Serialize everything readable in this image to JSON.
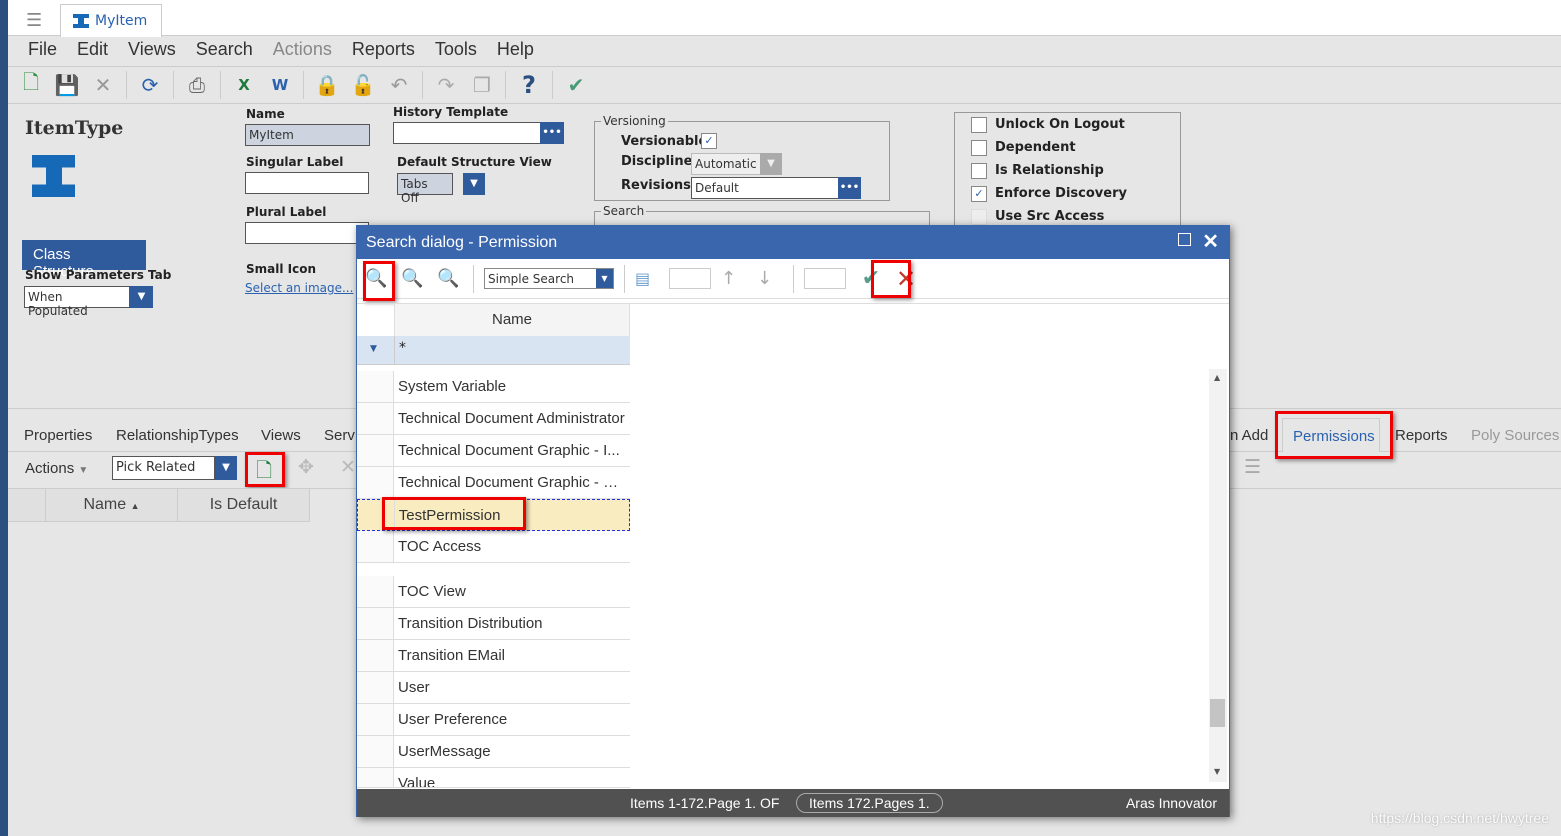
{
  "window": {
    "tab_title": "MyItem"
  },
  "menu": [
    "File",
    "Edit",
    "Views",
    "Search",
    "Actions",
    "Reports",
    "Tools",
    "Help"
  ],
  "form": {
    "heading": "ItemType",
    "class_structure": "Class Structure",
    "show_params_label": "Show Parameters Tab",
    "show_params_value": "When Populated",
    "name_label": "Name",
    "name_value": "MyItem",
    "singular_label": "Singular Label",
    "plural_label": "Plural Label",
    "small_icon_label": "Small Icon",
    "select_image": "Select an image...",
    "history_label": "History Template",
    "structure_view_label": "Default Structure View",
    "structure_view_value": "Tabs Off",
    "versioning_legend": "Versioning",
    "versionable": "Versionable",
    "discipline": "Discipline",
    "discipline_value": "Automatic",
    "revisions": "Revisions",
    "revisions_value": "Default",
    "search_legend": "Search",
    "checkboxes": [
      {
        "label": "Unlock On Logout",
        "checked": false
      },
      {
        "label": "Dependent",
        "checked": false
      },
      {
        "label": "Is Relationship",
        "checked": false
      },
      {
        "label": "Enforce Discovery",
        "checked": true
      },
      {
        "label": "Use Src Access",
        "checked": false
      }
    ]
  },
  "rel_tabs": {
    "left": [
      "Properties",
      "RelationshipTypes",
      "Views",
      "Serv"
    ],
    "right": [
      "n Add",
      "Permissions",
      "Reports",
      "Poly Sources"
    ],
    "active": "Permissions"
  },
  "rel_toolbar": {
    "actions": "Actions",
    "pick": "Pick Related"
  },
  "rel_grid": {
    "columns": [
      "Name",
      "Is Default"
    ]
  },
  "dialog": {
    "title": "Search dialog - Permission",
    "search_mode": "Simple Search",
    "column": "Name",
    "filter": "*",
    "rows": [
      "System Variable",
      "Technical Document Administrator",
      "Technical Document Graphic - I...",
      "Technical Document Graphic - R...",
      "TestPermission",
      "TOC Access"
    ],
    "rows2": [
      "TOC View",
      "Transition Distribution",
      "Transition EMail",
      "User",
      "User Preference",
      "UserMessage",
      "Value"
    ],
    "selected": "TestPermission",
    "status_left": "Items 1-172.Page 1. OF",
    "status_pill": "Items 172.Pages 1.",
    "brand": "Aras Innovator"
  },
  "watermark": "https://blog.csdn.net/hwytree"
}
